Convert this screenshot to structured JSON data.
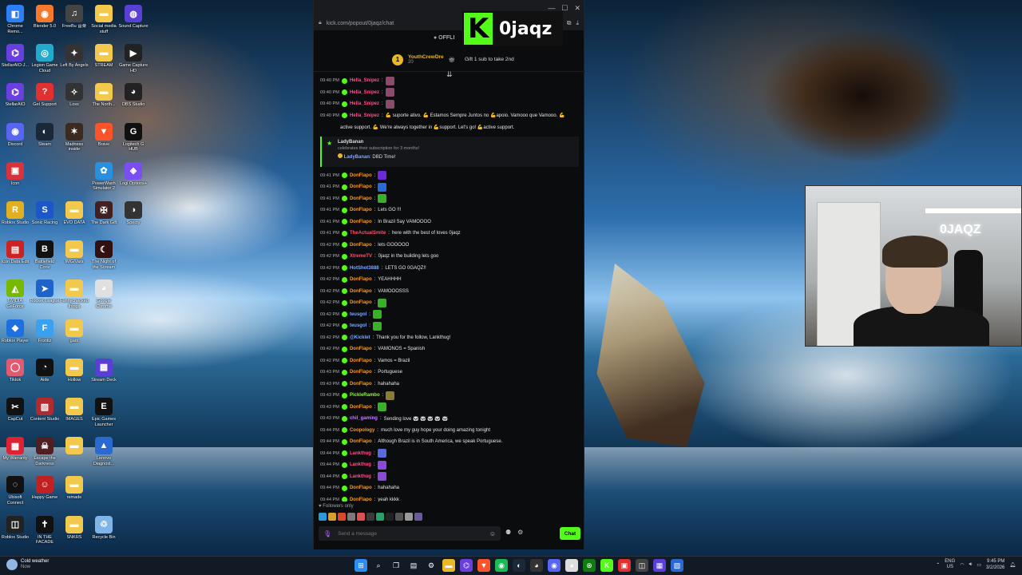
{
  "colors": {
    "kick_green": "#53fc18",
    "chat_bg": "#0b0c0e",
    "donflapo": "#ff9a1f",
    "pink": "#ff4f8b",
    "blue": "#7aa8ff",
    "green_name": "#8ef542",
    "purple": "#c77dff"
  },
  "desktop": {
    "icons": [
      {
        "label": "Chrome Remo...",
        "icon": "chrome-remote-icon",
        "color": "#2d7ff9",
        "glyph": "◧"
      },
      {
        "label": "Blender 5.0",
        "icon": "blender-icon",
        "color": "#f5792a",
        "glyph": "◉"
      },
      {
        "label": "FreeBu 音楽",
        "icon": "app-icon",
        "color": "#444",
        "glyph": "♫"
      },
      {
        "label": "Social media stuff",
        "icon": "folder-icon",
        "color": "#f2c94c",
        "glyph": "▬"
      },
      {
        "label": "Sound Capture",
        "icon": "sound-icon",
        "color": "#5a3fd4",
        "glyph": "◍"
      },
      {
        "label": "StellarAIO-J...",
        "icon": "stellar-icon",
        "color": "#6a3fe0",
        "glyph": "⌬"
      },
      {
        "label": "Legion Game Cloud",
        "icon": "legion-icon",
        "color": "#22aacc",
        "glyph": "◎"
      },
      {
        "label": "Left By Angels",
        "icon": "game-icon",
        "color": "#333",
        "glyph": "✦"
      },
      {
        "label": "STREAM",
        "icon": "folder-icon",
        "color": "#f2c94c",
        "glyph": "▬"
      },
      {
        "label": "Game Capture HD",
        "icon": "capture-icon",
        "color": "#222",
        "glyph": "▶"
      },
      {
        "label": "StellarAIO",
        "icon": "stellar-icon",
        "color": "#6a3fe0",
        "glyph": "⌬"
      },
      {
        "label": "Get Support",
        "icon": "support-icon",
        "color": "#e03030",
        "glyph": "?"
      },
      {
        "label": "Loss",
        "icon": "game-icon",
        "color": "#333",
        "glyph": "✧"
      },
      {
        "label": "The North...",
        "icon": "folder-icon",
        "color": "#f2c94c",
        "glyph": "▬"
      },
      {
        "label": "OBS Studio",
        "icon": "obs-icon",
        "color": "#222",
        "glyph": "◕"
      },
      {
        "label": "Discord",
        "icon": "discord-icon",
        "color": "#5865f2",
        "glyph": "◉"
      },
      {
        "label": "Steam",
        "icon": "steam-icon",
        "color": "#1b2838",
        "glyph": "◐"
      },
      {
        "label": "Madness inside",
        "icon": "game-icon",
        "color": "#3a2a20",
        "glyph": "✶"
      },
      {
        "label": "Brave",
        "icon": "brave-icon",
        "color": "#fb542b",
        "glyph": "▼"
      },
      {
        "label": "Logitech G HUB",
        "icon": "logitech-icon",
        "color": "#111",
        "glyph": "G"
      },
      {
        "label": "Icon",
        "icon": "app-icon",
        "color": "#d8333a",
        "glyph": "▣"
      },
      {
        "label": "",
        "icon": "blank-icon",
        "color": "transparent",
        "glyph": ""
      },
      {
        "label": "",
        "icon": "blank-icon",
        "color": "transparent",
        "glyph": ""
      },
      {
        "label": "PowerWash Simulator 2",
        "icon": "powerwash-icon",
        "color": "#2b8fe0",
        "glyph": "✿"
      },
      {
        "label": "Logi Options+",
        "icon": "logi-icon",
        "color": "#7a4ef0",
        "glyph": "◈"
      },
      {
        "label": "Roblox Studio",
        "icon": "roblox-icon",
        "color": "#e0b020",
        "glyph": "R"
      },
      {
        "label": "Sonic Racing",
        "icon": "game-icon",
        "color": "#1d56c8",
        "glyph": "S"
      },
      {
        "label": "EVO DATA",
        "icon": "folder-icon",
        "color": "#f2c94c",
        "glyph": "▬"
      },
      {
        "label": "The Dark Gift",
        "icon": "game-icon",
        "color": "#402020",
        "glyph": "✠"
      },
      {
        "label": "Specty",
        "icon": "specty-icon",
        "color": "#333",
        "glyph": "◑"
      },
      {
        "label": "Icon Data Edit",
        "icon": "app-icon",
        "color": "#c22",
        "glyph": "▤"
      },
      {
        "label": "Battlefield Conv",
        "icon": "game-icon",
        "color": "#111",
        "glyph": "B"
      },
      {
        "label": "IMG/Vars",
        "icon": "folder-icon",
        "color": "#f2c94c",
        "glyph": "▬"
      },
      {
        "label": "The Night of the Scream",
        "icon": "game-icon",
        "color": "#301010",
        "glyph": "☾"
      },
      {
        "label": "",
        "icon": "blank-icon",
        "color": "transparent",
        "glyph": ""
      },
      {
        "label": "NVIDIA GeForce",
        "icon": "nvidia-icon",
        "color": "#76b900",
        "glyph": "◭"
      },
      {
        "label": "Rocket League",
        "icon": "rocket-icon",
        "color": "#1e64c8",
        "glyph": "➤"
      },
      {
        "label": "Funnychecked things",
        "icon": "folder-icon",
        "color": "#f2c94c",
        "glyph": "▬"
      },
      {
        "label": "Google Chrome",
        "icon": "chrome-icon",
        "color": "#e0e0e0",
        "glyph": "◕"
      },
      {
        "label": "",
        "icon": "blank-icon",
        "color": "transparent",
        "glyph": ""
      },
      {
        "label": "Roblox Player",
        "icon": "roblox-icon",
        "color": "#1e6fe0",
        "glyph": "◆"
      },
      {
        "label": "Frontiz",
        "icon": "app-icon",
        "color": "#3aa0f0",
        "glyph": "F"
      },
      {
        "label": "gam",
        "icon": "folder-icon",
        "color": "#f2c94c",
        "glyph": "▬"
      },
      {
        "label": "",
        "icon": "blank-icon",
        "color": "transparent",
        "glyph": ""
      },
      {
        "label": "",
        "icon": "blank-icon",
        "color": "transparent",
        "glyph": ""
      },
      {
        "label": "Tiktok",
        "icon": "app-icon",
        "color": "#e05a70",
        "glyph": "◯"
      },
      {
        "label": "Aide",
        "icon": "app-icon",
        "color": "#111",
        "glyph": "◔"
      },
      {
        "label": "Hollow",
        "icon": "folder-icon",
        "color": "#f2c94c",
        "glyph": "▬"
      },
      {
        "label": "Stream Deck",
        "icon": "streamdeck-icon",
        "color": "#5a3fd4",
        "glyph": "▦"
      },
      {
        "label": "",
        "icon": "blank-icon",
        "color": "transparent",
        "glyph": ""
      },
      {
        "label": "CapCut",
        "icon": "capcut-icon",
        "color": "#111",
        "glyph": "✂"
      },
      {
        "label": "Content Studio",
        "icon": "app-icon",
        "color": "#b02a30",
        "glyph": "▧"
      },
      {
        "label": "IMAGES",
        "icon": "folder-icon",
        "color": "#f2c94c",
        "glyph": "▬"
      },
      {
        "label": "Epic Games Launcher",
        "icon": "epic-icon",
        "color": "#111",
        "glyph": "E"
      },
      {
        "label": "",
        "icon": "blank-icon",
        "color": "transparent",
        "glyph": ""
      },
      {
        "label": "My Warranty",
        "icon": "app-icon",
        "color": "#d23",
        "glyph": "▩"
      },
      {
        "label": "Escape the Darkness",
        "icon": "game-icon",
        "color": "#502020",
        "glyph": "☠"
      },
      {
        "label": "",
        "icon": "folder-icon",
        "color": "#f2c94c",
        "glyph": "▬"
      },
      {
        "label": "Lenovo Diagnost...",
        "icon": "lenovo-icon",
        "color": "#2a6ad0",
        "glyph": "▲"
      },
      {
        "label": "",
        "icon": "blank-icon",
        "color": "transparent",
        "glyph": ""
      },
      {
        "label": "Ubisoft Connect",
        "icon": "ubisoft-icon",
        "color": "#111",
        "glyph": "◌"
      },
      {
        "label": "Happy Game",
        "icon": "game-icon",
        "color": "#c02020",
        "glyph": "☺"
      },
      {
        "label": "remade",
        "icon": "folder-icon",
        "color": "#f2c94c",
        "glyph": "▬"
      },
      {
        "label": "",
        "icon": "blank-icon",
        "color": "transparent",
        "glyph": ""
      },
      {
        "label": "",
        "icon": "blank-icon",
        "color": "transparent",
        "glyph": ""
      },
      {
        "label": "Roblox Studio",
        "icon": "roblox-icon",
        "color": "#222",
        "glyph": "◫"
      },
      {
        "label": "IN THE FACADE",
        "icon": "game-icon",
        "color": "#111",
        "glyph": "✝"
      },
      {
        "label": "SNKRS",
        "icon": "folder-icon",
        "color": "#f2c94c",
        "glyph": "▬"
      },
      {
        "label": "Recycle Bin",
        "icon": "recycle-bin-icon",
        "color": "#7fb4e8",
        "glyph": "♲"
      }
    ]
  },
  "browser": {
    "url": "kick.com/popout/0jaqz/chat",
    "window_controls": [
      "—",
      "☐",
      "✕"
    ]
  },
  "channel": {
    "name": "0jaqz",
    "logo_glyph": "K",
    "status": "● OFFLI"
  },
  "pinned": {
    "gifter_rank": "1",
    "gifter_name": "YouthCrewDre",
    "gifter_count": "20",
    "gift_cta": "Gift 1 sub to take 2nd"
  },
  "chat": {
    "messages_top": [
      {
        "time": "09:40 PM",
        "user": "Hella_Snipez",
        "user_color": "#ff4f8b",
        "text": "",
        "emote_color": "#8a4a6a"
      },
      {
        "time": "09:40 PM",
        "user": "Hella_Snipez",
        "user_color": "#ff4f8b",
        "text": "",
        "emote_color": "#8a4a6a"
      },
      {
        "time": "09:40 PM",
        "user": "Hella_Snipez",
        "user_color": "#ff4f8b",
        "text": "",
        "emote_color": "#8a4a6a"
      },
      {
        "time": "09:40 PM",
        "user": "Hella_Snipez",
        "user_color": "#ff4f8b",
        "text": "💪 suporte ativo. 💪 Estamos Sempre Juntos no 💪apoio. Vamooo que Vamooo. 💪",
        "emote_color": ""
      },
      {
        "time": "",
        "user": "",
        "user_color": "#ff4f8b",
        "text": "active support. 💪 We're always together in 💪support. Let's go! 💪active support.",
        "emote_color": ""
      }
    ],
    "subscription": {
      "user": "LadyBanan",
      "description": "celebrates their subscription for 3 months!",
      "message_user": "LadyBanan",
      "message_text": "DBD Time!"
    },
    "messages": [
      {
        "time": "09:41 PM",
        "user": "DonFlapo",
        "user_color": "#ff9a1f",
        "text": "",
        "emote_color": "#6a2ad8"
      },
      {
        "time": "09:41 PM",
        "user": "DonFlapo",
        "user_color": "#ff9a1f",
        "text": "",
        "emote_color": "#2a6ad8"
      },
      {
        "time": "09:41 PM",
        "user": "DonFlapo",
        "user_color": "#ff9a1f",
        "text": "",
        "emote_color": "#3ab02a"
      },
      {
        "time": "09:41 PM",
        "user": "DonFlapo",
        "user_color": "#ff9a1f",
        "text": "Lets GO !!!",
        "emote_color": ""
      },
      {
        "time": "09:41 PM",
        "user": "DonFlapo",
        "user_color": "#ff9a1f",
        "text": "In Brazil Say VAMOOOO",
        "emote_color": ""
      },
      {
        "time": "09:41 PM",
        "user": "TheActualSmite",
        "user_color": "#ff4f6a",
        "text": "here with the best of loves 0jaqz",
        "emote_color": ""
      },
      {
        "time": "09:42 PM",
        "user": "DonFlapo",
        "user_color": "#ff9a1f",
        "text": "lets GOOOOO",
        "emote_color": ""
      },
      {
        "time": "09:42 PM",
        "user": "XtremeTV",
        "user_color": "#ff4f6a",
        "text": "0jaqz in the building lets goo",
        "emote_color": ""
      },
      {
        "time": "09:42 PM",
        "user": "HotShot3888",
        "user_color": "#7aa8ff",
        "text": "LETS GO 0GAQZ!!",
        "emote_color": ""
      },
      {
        "time": "09:42 PM",
        "user": "DonFlapo",
        "user_color": "#ff9a1f",
        "text": "YEAHHHH",
        "emote_color": ""
      },
      {
        "time": "09:42 PM",
        "user": "DonFlapo",
        "user_color": "#ff9a1f",
        "text": "VAMOOOSSS",
        "emote_color": ""
      },
      {
        "time": "09:42 PM",
        "user": "DonFlapo",
        "user_color": "#ff9a1f",
        "text": "",
        "emote_color": "#3ab02a"
      },
      {
        "time": "09:42 PM",
        "user": "teusgol",
        "user_color": "#7aa8ff",
        "text": "",
        "emote_color": "#3ab02a"
      },
      {
        "time": "09:42 PM",
        "user": "teusgol",
        "user_color": "#7aa8ff",
        "text": "",
        "emote_color": "#3ab02a"
      },
      {
        "time": "09:42 PM",
        "user": "@Kicklet",
        "user_color": "#7aa8ff",
        "text": "Thank you for the follow, Lankthug!",
        "emote_color": ""
      },
      {
        "time": "09:42 PM",
        "user": "DonFlapo",
        "user_color": "#ff9a1f",
        "text": "VAMONOS = Spanish",
        "emote_color": ""
      },
      {
        "time": "09:42 PM",
        "user": "DonFlapo",
        "user_color": "#ff9a1f",
        "text": "Vamos = Brazil",
        "emote_color": ""
      },
      {
        "time": "09:43 PM",
        "user": "DonFlapo",
        "user_color": "#ff9a1f",
        "text": "Portuguese",
        "emote_color": ""
      },
      {
        "time": "09:43 PM",
        "user": "DonFlapo",
        "user_color": "#ff9a1f",
        "text": "hahahaha",
        "emote_color": ""
      },
      {
        "time": "09:43 PM",
        "user": "PickleRambo",
        "user_color": "#8ef542",
        "text": "",
        "emote_color": "#8a7a3a"
      },
      {
        "time": "09:43 PM",
        "user": "DonFlapo",
        "user_color": "#ff9a1f",
        "text": "",
        "emote_color": "#3ab02a"
      },
      {
        "time": "09:43 PM",
        "user": "chil_gaming",
        "user_color": "#c77dff",
        "text": "Sending love 🐼 🐼 🐼 🐼 🐼",
        "emote_color": ""
      },
      {
        "time": "09:44 PM",
        "user": "Coopology",
        "user_color": "#ff9a1f",
        "text": "much love my guy hope your doing amazing tonight",
        "emote_color": ""
      },
      {
        "time": "09:44 PM",
        "user": "DonFlapo",
        "user_color": "#ff9a1f",
        "text": "Although Brazil is in South America, we speak Portuguese.",
        "emote_color": ""
      },
      {
        "time": "09:44 PM",
        "user": "Lankthug",
        "user_color": "#ff4f8b",
        "text": "",
        "emote_color": "#5a6ad8"
      },
      {
        "time": "09:44 PM",
        "user": "Lankthug",
        "user_color": "#ff4f8b",
        "text": "",
        "emote_color": "#8a4ad8"
      },
      {
        "time": "09:44 PM",
        "user": "Lankthug",
        "user_color": "#ff4f8b",
        "text": "",
        "emote_color": "#8a4ad8"
      },
      {
        "time": "09:44 PM",
        "user": "DonFlapo",
        "user_color": "#ff9a1f",
        "text": "hahahaha",
        "emote_color": ""
      },
      {
        "time": "09:44 PM",
        "user": "DonFlapo",
        "user_color": "#ff9a1f",
        "text": "yeah kkkk",
        "emote_color": ""
      }
    ],
    "followers_only": "♥ Followers only",
    "input_placeholder": "Send a message",
    "send_label": "Chat"
  },
  "webcam": {
    "neon_text": "0JAQZ"
  },
  "taskbar": {
    "weather_title": "Cold weather",
    "weather_sub": "Now",
    "apps": [
      {
        "icon": "windows-start-icon",
        "color": "#2d8cf0",
        "glyph": "⊞"
      },
      {
        "icon": "search-icon",
        "color": "transparent",
        "glyph": "⌕"
      },
      {
        "icon": "task-view-icon",
        "color": "transparent",
        "glyph": "❐"
      },
      {
        "icon": "widgets-icon",
        "color": "transparent",
        "glyph": "▤"
      },
      {
        "icon": "settings-icon",
        "color": "transparent",
        "glyph": "⚙"
      },
      {
        "icon": "file-explorer-icon",
        "color": "#e8b829",
        "glyph": "▬"
      },
      {
        "icon": "stellar-icon",
        "color": "#6a3fe0",
        "glyph": "⌬"
      },
      {
        "icon": "brave-icon",
        "color": "#fb542b",
        "glyph": "▼"
      },
      {
        "icon": "spotify-icon",
        "color": "#1db954",
        "glyph": "◉"
      },
      {
        "icon": "steam-icon",
        "color": "#1b2838",
        "glyph": "◐"
      },
      {
        "icon": "obs-icon",
        "color": "#333",
        "glyph": "◕"
      },
      {
        "icon": "discord-icon",
        "color": "#5865f2",
        "glyph": "◉"
      },
      {
        "icon": "chrome-icon",
        "color": "#ddd",
        "glyph": "◕"
      },
      {
        "icon": "xbox-icon",
        "color": "#107c10",
        "glyph": "⊗"
      },
      {
        "icon": "kick-icon",
        "color": "#53fc18",
        "glyph": "K"
      },
      {
        "icon": "app-icon",
        "color": "#e03030",
        "glyph": "▣"
      },
      {
        "icon": "app-icon",
        "color": "#444",
        "glyph": "◫"
      },
      {
        "icon": "app-icon",
        "color": "#5a3fd4",
        "glyph": "▦"
      },
      {
        "icon": "app-icon",
        "color": "#2a6ad0",
        "glyph": "▧"
      }
    ],
    "lang_top": "ENG",
    "lang_bottom": "US",
    "time": "9:45 PM",
    "date": "3/2/2026"
  }
}
